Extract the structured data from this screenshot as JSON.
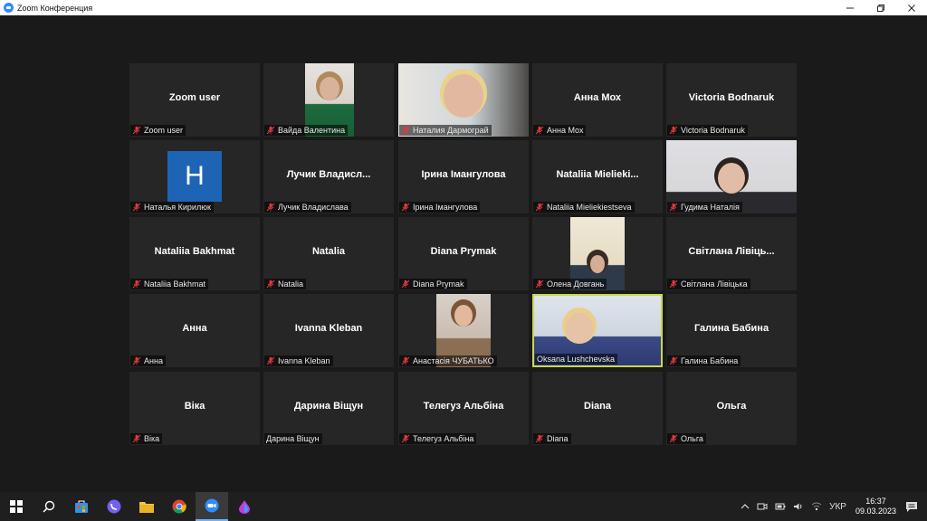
{
  "window": {
    "title": "Zoom Конференция",
    "controls": [
      "minimize",
      "maximize",
      "close"
    ]
  },
  "gallery": {
    "tiles": [
      {
        "display_name": "Zoom user",
        "label": "Zoom user",
        "muted": true,
        "video": false
      },
      {
        "display_name": "",
        "label": "Вайда Валентина",
        "muted": true,
        "video": true
      },
      {
        "display_name": "",
        "label": "Наталия Дармограй",
        "muted": true,
        "video": true
      },
      {
        "display_name": "Анна Мох",
        "label": "Анна Мох",
        "muted": true,
        "video": false
      },
      {
        "display_name": "Victoria Bodnaruk",
        "label": "Victoria Bodnaruk",
        "muted": true,
        "video": false
      },
      {
        "display_name": "",
        "label": "Наталья Кирилюк",
        "muted": true,
        "video": false,
        "avatar_letter": "H"
      },
      {
        "display_name": "Лучик Владисл...",
        "label": "Лучик Владислава",
        "muted": true,
        "video": false
      },
      {
        "display_name": "Ірина Імангулова",
        "label": "Ірина Імангулова",
        "muted": true,
        "video": false
      },
      {
        "display_name": "Nataliia Mieliеki...",
        "label": "Nataliia Mieliekiestseva",
        "muted": true,
        "video": false
      },
      {
        "display_name": "",
        "label": "Гудима Наталія",
        "muted": true,
        "video": true
      },
      {
        "display_name": "Nataliia Bakhmat",
        "label": "Nataliia Bakhmat",
        "muted": true,
        "video": false
      },
      {
        "display_name": "Natalia",
        "label": "Natalia",
        "muted": true,
        "video": false
      },
      {
        "display_name": "Diana Prymak",
        "label": "Diana Prymak",
        "muted": true,
        "video": false
      },
      {
        "display_name": "",
        "label": "Олена Довгань",
        "muted": true,
        "video": true
      },
      {
        "display_name": "Світлана Лівіць...",
        "label": "Світлана Лівіцька",
        "muted": true,
        "video": false
      },
      {
        "display_name": "Анна",
        "label": "Анна",
        "muted": true,
        "video": false
      },
      {
        "display_name": "Ivanna Kleban",
        "label": "Ivanna Kleban",
        "muted": true,
        "video": false
      },
      {
        "display_name": "",
        "label": "Анастасія ЧУБАТЬКО",
        "muted": true,
        "video": true
      },
      {
        "display_name": "",
        "label": "Oksana Lushchevska",
        "muted": false,
        "video": true,
        "active_speaker": true
      },
      {
        "display_name": "Галина Бабина",
        "label": "Галина Бабина",
        "muted": true,
        "video": false
      },
      {
        "display_name": "Віка",
        "label": "Віка",
        "muted": true,
        "video": false
      },
      {
        "display_name": "Дарина Віщун",
        "label": "Дарина Віщун",
        "muted": false,
        "video": false
      },
      {
        "display_name": "Телегуз Альбіна",
        "label": "Телегуз Альбіна",
        "muted": true,
        "video": false
      },
      {
        "display_name": "Diana",
        "label": "Diana",
        "muted": true,
        "video": false
      },
      {
        "display_name": "Ольга",
        "label": "Ольга",
        "muted": true,
        "video": false
      }
    ]
  },
  "taskbar": {
    "apps": [
      "windows-start",
      "search",
      "store",
      "viber",
      "file-explorer",
      "chrome",
      "zoom",
      "drop-app"
    ],
    "tray": {
      "language": "УКР",
      "time": "16:37",
      "date": "09.03.2023"
    }
  },
  "colors": {
    "background": "#1a1a1a",
    "tile": "#262626",
    "active_speaker_border": "#c8d84b",
    "muted_icon": "#e0393e",
    "avatar": "#1e64b4"
  }
}
